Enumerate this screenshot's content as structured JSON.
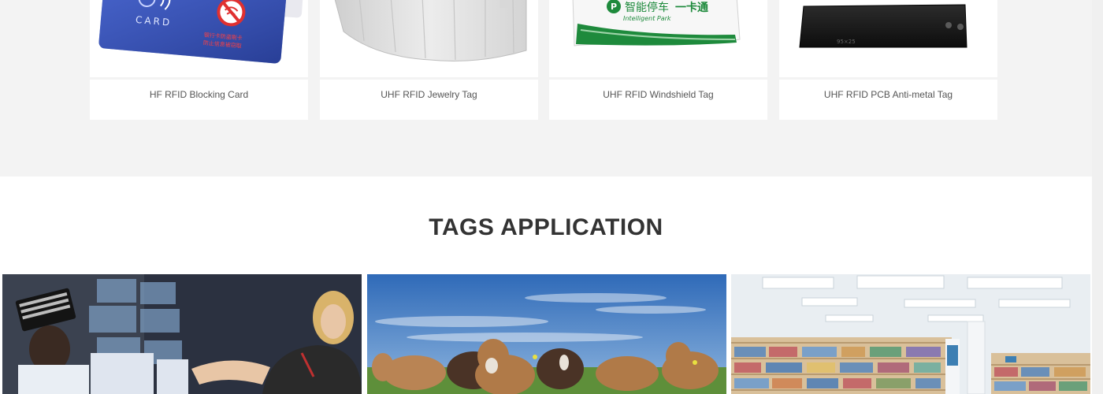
{
  "products": [
    {
      "label": "HF RFID Blocking Card",
      "image": "blocking-card-image"
    },
    {
      "label": "UHF RFID Jewelry Tag",
      "image": "jewelry-tag-image"
    },
    {
      "label": "UHF RFID Windshield Tag",
      "image": "windshield-tag-image"
    },
    {
      "label": "UHF RFID PCB Anti-metal Tag",
      "image": "pcb-tag-image"
    }
  ],
  "card_art": {
    "card_text": "CARD",
    "card_cn_line1": "银行卡防盗刷卡",
    "card_cn_line2": "防止信息被窃取",
    "windshield_brand_cn": "智能停车",
    "windshield_card_cn": "一卡通",
    "windshield_brand_en": "Intelligent Park",
    "pcb_marking": "95×25"
  },
  "section": {
    "title": "TAGS APPLICATION"
  },
  "applications": [
    {
      "image": "warehouse-logistics-image"
    },
    {
      "image": "livestock-cattle-image"
    },
    {
      "image": "library-bookshelves-image"
    }
  ],
  "colors": {
    "page_bg": "#f3f3f3",
    "card_bg": "#ffffff",
    "title": "#333333",
    "label": "#555555"
  }
}
